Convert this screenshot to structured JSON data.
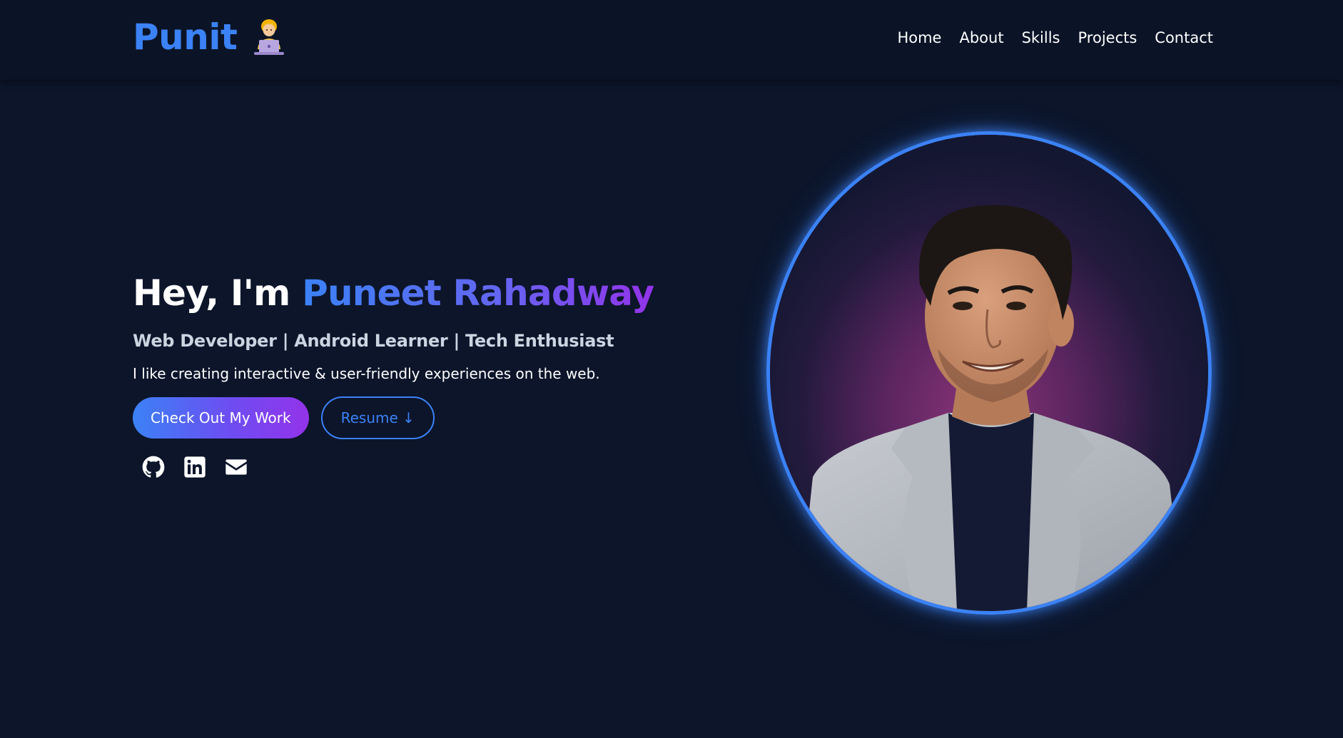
{
  "header": {
    "logo_text": "Punit",
    "logo_emoji": "technologist-emoji",
    "nav": [
      "Home",
      "About",
      "Skills",
      "Projects",
      "Contact"
    ]
  },
  "hero": {
    "greeting": "Hey, I'm",
    "name": "Puneet Rahadway",
    "subtitle": "Web Developer | Android Learner | Tech Enthusiast",
    "description": "I like creating interactive & user-friendly experiences on the web.",
    "primary_button": "Check Out My Work",
    "secondary_button": "Resume ↓",
    "socials": [
      "github-icon",
      "linkedin-icon",
      "mail-icon"
    ]
  },
  "colors": {
    "background": "#0c152a",
    "accent": "#3b82f6",
    "accent_purple": "#9333ea"
  }
}
